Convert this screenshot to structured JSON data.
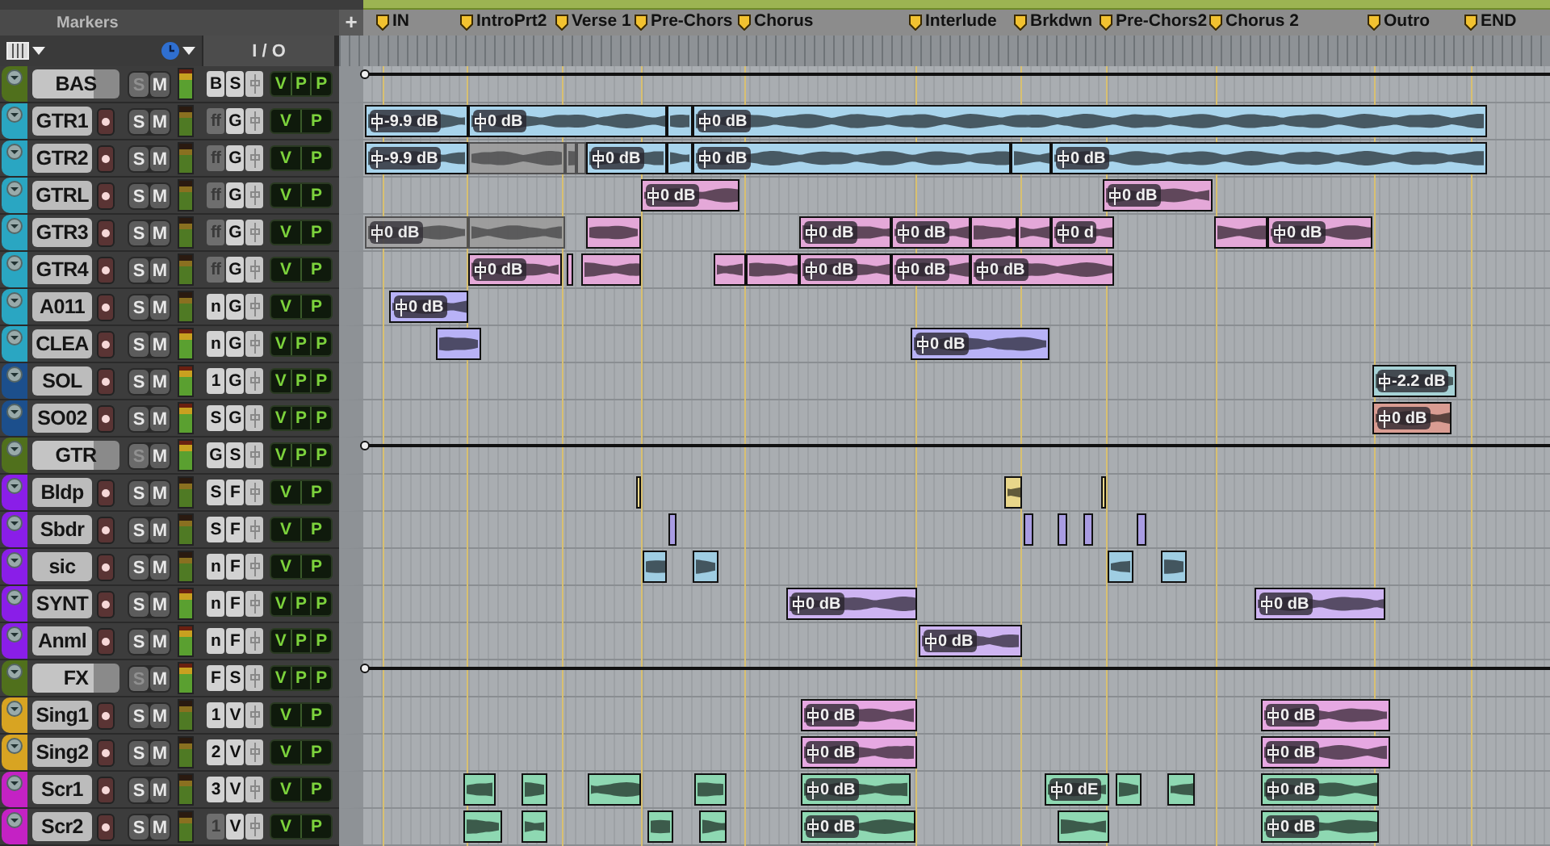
{
  "markers_ruler": {
    "title": "Markers",
    "add_button": "+",
    "markers": [
      {
        "label": "IN"
      },
      {
        "label": "IntroPrt2"
      },
      {
        "label": "Verse 1"
      },
      {
        "label": "Pre-Chors"
      },
      {
        "label": "Chorus"
      },
      {
        "label": "Interlude"
      },
      {
        "label": "Brkdwn"
      },
      {
        "label": "Pre-Chors2"
      },
      {
        "label": "Chorus 2"
      },
      {
        "label": "Outro"
      },
      {
        "label": "END"
      }
    ]
  },
  "header": {
    "io_title": "I / O"
  },
  "tracks": [
    {
      "kind": "aux",
      "name": "BAS",
      "color": "#50701c",
      "solo_label": "S",
      "mute_label": "M",
      "io": [
        {
          "text": "B",
          "dim": false
        },
        {
          "text": "S",
          "dim": false
        }
      ],
      "views": [
        "V",
        "P",
        "P"
      ]
    },
    {
      "kind": "audio",
      "name": "GTR1",
      "color": "#2aa6c2",
      "solo_label": "S",
      "mute_label": "M",
      "io": [
        {
          "text": "ff",
          "dim": true
        },
        {
          "text": "G",
          "dim": false
        }
      ],
      "views": [
        "V",
        "P"
      ],
      "clips": [
        {
          "gain": "-9.9 dB",
          "muted": false,
          "color": "#a8d4ec"
        },
        {
          "gain": "0 dB",
          "muted": false,
          "color": "#a8d4ec"
        },
        {
          "muted": false,
          "color": "#a8d4ec"
        },
        {
          "gain": "0 dB",
          "muted": false,
          "color": "#a8d4ec"
        }
      ]
    },
    {
      "kind": "audio",
      "name": "GTR2",
      "color": "#2aa6c2",
      "solo_label": "S",
      "mute_label": "M",
      "io": [
        {
          "text": "ff",
          "dim": true
        },
        {
          "text": "G",
          "dim": false
        }
      ],
      "views": [
        "V",
        "P"
      ],
      "clips": [
        {
          "gain": "-9.9 dB",
          "muted": false,
          "color": "#a8d4ec"
        },
        {
          "muted": true,
          "color": "#9c9c9c"
        },
        {
          "muted": true,
          "color": "#9c9c9c"
        },
        {
          "muted": true,
          "color": "#9c9c9c"
        },
        {
          "gain": "0 dB",
          "muted": false,
          "color": "#a8d4ec"
        },
        {
          "muted": false,
          "color": "#a8d4ec"
        },
        {
          "gain": "0 dB",
          "muted": false,
          "color": "#a8d4ec"
        },
        {
          "muted": false,
          "color": "#a8d4ec"
        },
        {
          "gain": "0 dB",
          "muted": false,
          "color": "#a8d4ec"
        }
      ]
    },
    {
      "kind": "audio",
      "name": "GTRL",
      "color": "#2aa6c2",
      "solo_label": "S",
      "mute_label": "M",
      "io": [
        {
          "text": "ff",
          "dim": true
        },
        {
          "text": "G",
          "dim": false
        }
      ],
      "views": [
        "V",
        "P"
      ],
      "clips": [
        {
          "gain": "0 dB",
          "muted": false,
          "color": "#e4a8d8"
        },
        {
          "gain": "0 dB",
          "muted": false,
          "color": "#e4a8d8"
        }
      ]
    },
    {
      "kind": "audio",
      "name": "GTR3",
      "color": "#2aa6c2",
      "solo_label": "S",
      "mute_label": "M",
      "io": [
        {
          "text": "ff",
          "dim": true
        },
        {
          "text": "G",
          "dim": false
        }
      ],
      "views": [
        "V",
        "P"
      ],
      "clips": [
        {
          "gain": "0 dB",
          "muted": true,
          "color": "#a4a4a4"
        },
        {
          "muted": true,
          "color": "#9c9c9c"
        },
        {
          "muted": false,
          "color": "#e4a8d8"
        },
        {
          "gain": "0 dB",
          "muted": false,
          "color": "#e4a8d8"
        },
        {
          "gain": "0 dB",
          "muted": false,
          "color": "#e4a8d8"
        },
        {
          "muted": false,
          "color": "#e4a8d8"
        },
        {
          "muted": false,
          "color": "#e4a8d8"
        },
        {
          "gain": "0 d",
          "muted": false,
          "color": "#e4a8d8"
        },
        {
          "muted": false,
          "color": "#e4a8d8"
        },
        {
          "gain": "0 dB",
          "muted": false,
          "color": "#e4a8d8"
        }
      ]
    },
    {
      "kind": "audio",
      "name": "GTR4",
      "color": "#2aa6c2",
      "solo_label": "S",
      "mute_label": "M",
      "io": [
        {
          "text": "ff",
          "dim": true
        },
        {
          "text": "G",
          "dim": false
        }
      ],
      "views": [
        "V",
        "P"
      ],
      "clips": [
        {
          "gain": "0 dB",
          "muted": false,
          "color": "#e4a8d8"
        },
        {
          "muted": false,
          "color": "#e4a8d8"
        },
        {
          "muted": false,
          "color": "#e4a8d8"
        },
        {
          "muted": false,
          "color": "#e4a8d8"
        },
        {
          "muted": false,
          "color": "#e4a8d8"
        },
        {
          "gain": "0 dB",
          "muted": false,
          "color": "#e4a8d8"
        },
        {
          "gain": "0 dB",
          "muted": false,
          "color": "#e4a8d8"
        },
        {
          "gain": "0 dB",
          "muted": false,
          "color": "#e4a8d8"
        }
      ]
    },
    {
      "kind": "audio",
      "name": "A011",
      "color": "#2aa6c2",
      "solo_label": "S",
      "mute_label": "M",
      "io": [
        {
          "text": "n",
          "dim": false
        },
        {
          "text": "G",
          "dim": false
        }
      ],
      "views": [
        "V",
        "P"
      ],
      "clips": [
        {
          "gain": "0 dB",
          "muted": false,
          "color": "#b8b2f6"
        }
      ]
    },
    {
      "kind": "audio",
      "name": "CLEA",
      "color": "#2aa6c2",
      "solo_label": "S",
      "mute_label": "M",
      "io": [
        {
          "text": "n",
          "dim": false
        },
        {
          "text": "G",
          "dim": false
        }
      ],
      "views": [
        "V",
        "P",
        "P"
      ],
      "clips": [
        {
          "muted": false,
          "color": "#b8b2f6"
        },
        {
          "gain": "0 dB",
          "muted": false,
          "color": "#b8b2f6"
        }
      ]
    },
    {
      "kind": "audio",
      "name": "SOL",
      "color": "#1c4f8c",
      "solo_label": "S",
      "mute_label": "M",
      "io": [
        {
          "text": "1",
          "dim": false
        },
        {
          "text": "G",
          "dim": false
        }
      ],
      "views": [
        "V",
        "P",
        "P"
      ],
      "clips": [
        {
          "gain": "-2.2 dB",
          "muted": false,
          "color": "#a6d2d6"
        }
      ]
    },
    {
      "kind": "audio",
      "name": "SO02",
      "color": "#1c4f8c",
      "solo_label": "S",
      "mute_label": "M",
      "io": [
        {
          "text": "S",
          "dim": false
        },
        {
          "text": "G",
          "dim": false
        }
      ],
      "views": [
        "V",
        "P",
        "P"
      ],
      "clips": [
        {
          "gain": "0 dB",
          "muted": false,
          "color": "#d99c92"
        }
      ]
    },
    {
      "kind": "aux",
      "name": "GTR",
      "color": "#50701c",
      "solo_label": "S",
      "mute_label": "M",
      "io": [
        {
          "text": "G",
          "dim": false
        },
        {
          "text": "S",
          "dim": false
        }
      ],
      "views": [
        "V",
        "P",
        "P"
      ]
    },
    {
      "kind": "audio",
      "name": "Bldp",
      "color": "#8a1ee8",
      "solo_label": "S",
      "mute_label": "M",
      "io": [
        {
          "text": "S",
          "dim": false
        },
        {
          "text": "F",
          "dim": false
        }
      ],
      "views": [
        "V",
        "P"
      ],
      "clips": [
        {
          "muted": false,
          "color": "#e8d68a"
        },
        {
          "muted": false,
          "color": "#e8d68a"
        },
        {
          "muted": false,
          "color": "#e8d68a"
        }
      ]
    },
    {
      "kind": "audio",
      "name": "Sbdr",
      "color": "#8a1ee8",
      "solo_label": "S",
      "mute_label": "M",
      "io": [
        {
          "text": "S",
          "dim": false
        },
        {
          "text": "F",
          "dim": false
        }
      ],
      "views": [
        "V",
        "P"
      ],
      "clips": [
        {
          "muted": false,
          "color": "#a99ce2"
        },
        {
          "muted": false,
          "color": "#a99ce2"
        },
        {
          "muted": false,
          "color": "#a99ce2"
        },
        {
          "muted": false,
          "color": "#a99ce2"
        },
        {
          "muted": false,
          "color": "#a99ce2"
        }
      ]
    },
    {
      "kind": "audio",
      "name": "sic",
      "color": "#8a1ee8",
      "solo_label": "S",
      "mute_label": "M",
      "io": [
        {
          "text": "n",
          "dim": false
        },
        {
          "text": "F",
          "dim": false
        }
      ],
      "views": [
        "V",
        "P"
      ],
      "clips": [
        {
          "muted": false,
          "color": "#9fcde2"
        },
        {
          "muted": false,
          "color": "#9fcde2"
        },
        {
          "muted": false,
          "color": "#9fcde2"
        },
        {
          "muted": false,
          "color": "#9fcde2"
        }
      ]
    },
    {
      "kind": "audio",
      "name": "SYNT",
      "color": "#8a1ee8",
      "solo_label": "S",
      "mute_label": "M",
      "io": [
        {
          "text": "n",
          "dim": false
        },
        {
          "text": "F",
          "dim": false
        }
      ],
      "views": [
        "V",
        "P",
        "P"
      ],
      "clips": [
        {
          "gain": "0 dB",
          "muted": false,
          "color": "#ceb4f2"
        },
        {
          "gain": "0 dB",
          "muted": false,
          "color": "#ceb4f2"
        }
      ]
    },
    {
      "kind": "audio",
      "name": "Anml",
      "color": "#8a1ee8",
      "solo_label": "S",
      "mute_label": "M",
      "io": [
        {
          "text": "n",
          "dim": false
        },
        {
          "text": "F",
          "dim": false
        }
      ],
      "views": [
        "V",
        "P",
        "P"
      ],
      "clips": [
        {
          "gain": "0 dB",
          "muted": false,
          "color": "#ceb4f2"
        }
      ]
    },
    {
      "kind": "aux",
      "name": "FX",
      "color": "#50701c",
      "solo_label": "S",
      "mute_label": "M",
      "io": [
        {
          "text": "F",
          "dim": false
        },
        {
          "text": "S",
          "dim": false
        }
      ],
      "views": [
        "V",
        "P",
        "P"
      ]
    },
    {
      "kind": "audio",
      "name": "Sing1",
      "color": "#d8a422",
      "solo_label": "S",
      "mute_label": "M",
      "io": [
        {
          "text": "1",
          "dim": false
        },
        {
          "text": "V",
          "dim": false
        }
      ],
      "views": [
        "V",
        "P"
      ],
      "clips": [
        {
          "gain": "0 dB",
          "muted": false,
          "color": "#e6a8e2"
        },
        {
          "gain": "0 dB",
          "muted": false,
          "color": "#e6a8e2"
        }
      ]
    },
    {
      "kind": "audio",
      "name": "Sing2",
      "color": "#d8a422",
      "solo_label": "S",
      "mute_label": "M",
      "io": [
        {
          "text": "2",
          "dim": false
        },
        {
          "text": "V",
          "dim": false
        }
      ],
      "views": [
        "V",
        "P"
      ],
      "clips": [
        {
          "gain": "0 dB",
          "muted": false,
          "color": "#e6a8e2"
        },
        {
          "gain": "0 dB",
          "muted": false,
          "color": "#e6a8e2"
        }
      ]
    },
    {
      "kind": "audio",
      "name": "Scr1",
      "color": "#c422c4",
      "solo_label": "S",
      "mute_label": "M",
      "io": [
        {
          "text": "3",
          "dim": false
        },
        {
          "text": "V",
          "dim": false
        }
      ],
      "views": [
        "V",
        "P"
      ],
      "clips": [
        {
          "muted": false,
          "color": "#8ed8b2"
        },
        {
          "muted": false,
          "color": "#8ed8b2"
        },
        {
          "muted": false,
          "color": "#8ed8b2"
        },
        {
          "muted": false,
          "color": "#8ed8b2"
        },
        {
          "gain": "0 dB",
          "muted": false,
          "color": "#8ed8b2"
        },
        {
          "gain": "0 dE",
          "muted": false,
          "color": "#8ed8b2"
        },
        {
          "muted": false,
          "color": "#8ed8b2"
        },
        {
          "muted": false,
          "color": "#8ed8b2"
        },
        {
          "gain": "0 dB",
          "muted": false,
          "color": "#8ed8b2"
        }
      ]
    },
    {
      "kind": "audio",
      "name": "Scr2",
      "color": "#c422c4",
      "solo_label": "S",
      "mute_label": "M",
      "io": [
        {
          "text": "1",
          "dim": true
        },
        {
          "text": "V",
          "dim": false
        }
      ],
      "views": [
        "V",
        "P"
      ],
      "clips": [
        {
          "muted": false,
          "color": "#8ed8b2"
        },
        {
          "muted": false,
          "color": "#8ed8b2"
        },
        {
          "muted": false,
          "color": "#8ed8b2"
        },
        {
          "muted": false,
          "color": "#8ed8b2"
        },
        {
          "gain": "0 dB",
          "muted": false,
          "color": "#8ed8b2"
        },
        {
          "muted": false,
          "color": "#8ed8b2"
        },
        {
          "gain": "0 dB",
          "muted": false,
          "color": "#8ed8b2"
        }
      ]
    }
  ]
}
